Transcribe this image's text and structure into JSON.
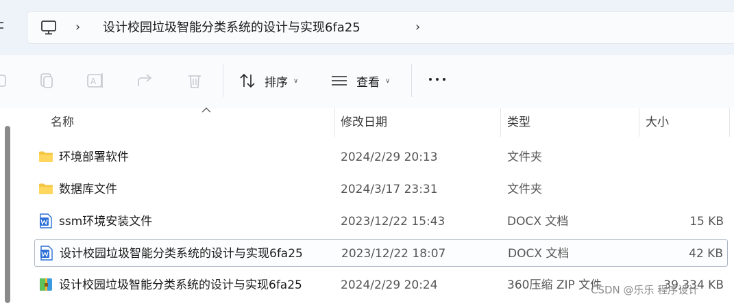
{
  "address_bar": {
    "path": "设计校园垃圾智能分类系统的设计与实现6fa25"
  },
  "toolbar": {
    "sort_label": "排序",
    "view_label": "查看"
  },
  "columns": {
    "name": "名称",
    "date": "修改日期",
    "type": "类型",
    "size": "大小"
  },
  "files": [
    {
      "name": "环境部署软件",
      "date": "2024/2/29 20:13",
      "type": "文件夹",
      "size": "",
      "icon": "folder-icon"
    },
    {
      "name": "数据库文件",
      "date": "2024/3/17 23:31",
      "type": "文件夹",
      "size": "",
      "icon": "folder-icon"
    },
    {
      "name": "ssm环境安装文件",
      "date": "2023/12/22 15:43",
      "type": "DOCX 文档",
      "size": "15 KB",
      "icon": "word-doc-icon"
    },
    {
      "name": "设计校园垃圾智能分类系统的设计与实现6fa25",
      "date": "2023/12/22 18:07",
      "type": "DOCX 文档",
      "size": "42 KB",
      "icon": "word-doc-icon",
      "selected": true
    },
    {
      "name": "设计校园垃圾智能分类系统的设计与实现6fa25",
      "date": "2024/2/29 20:24",
      "type": "360压缩 ZIP 文件",
      "size": "39,334 KB",
      "icon": "zip-archive-icon"
    }
  ],
  "watermark": "CSDN @乐乐 程序设计",
  "colors": {
    "folder": "#f4c542",
    "word": "#2b6fd6",
    "selection_border": "#aeb8c4",
    "topbar_bg": "#eef3f9"
  }
}
